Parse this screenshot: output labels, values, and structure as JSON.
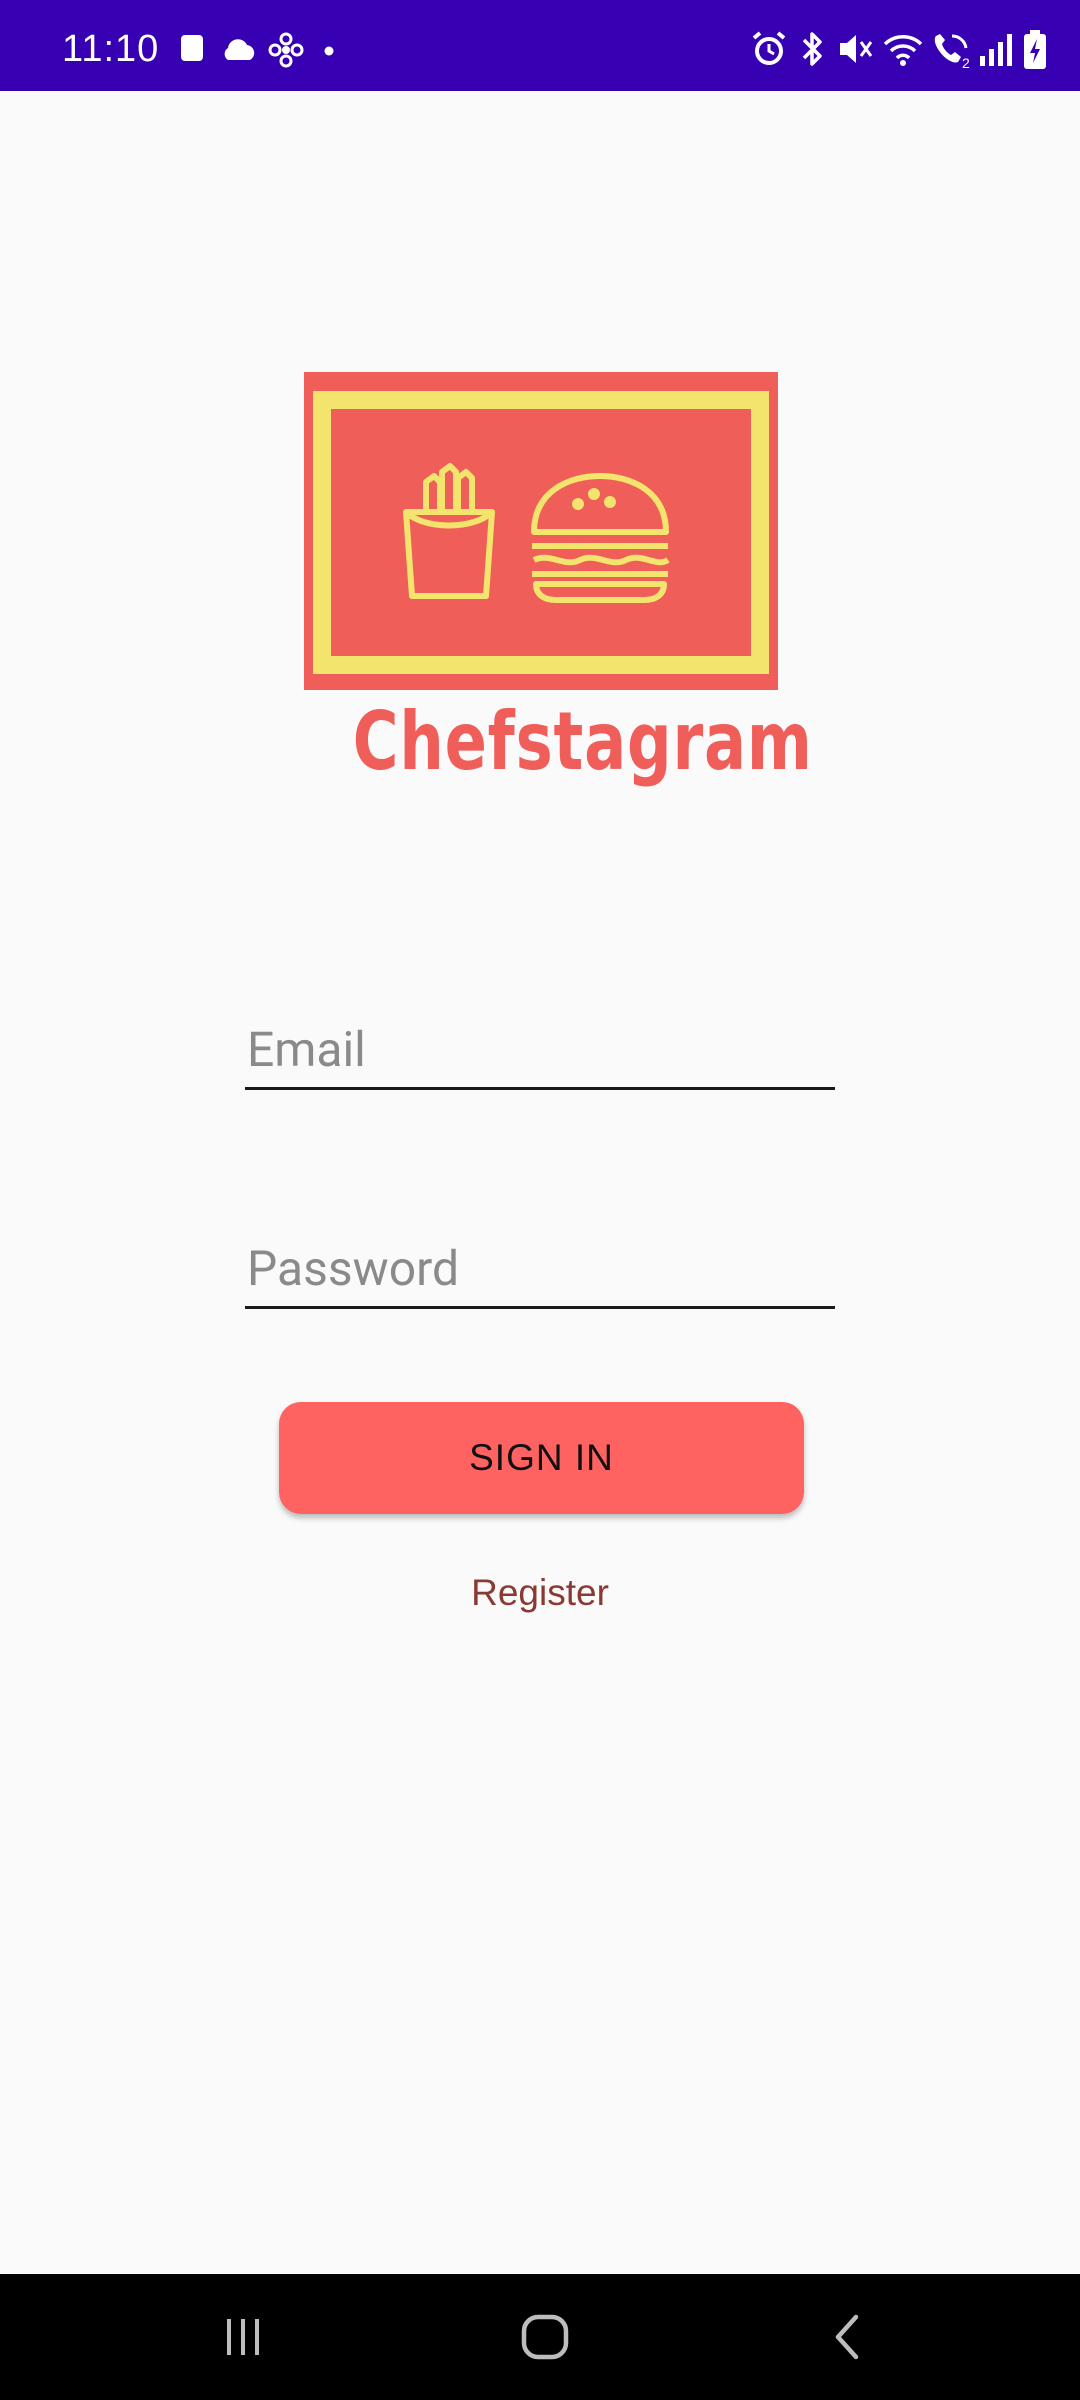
{
  "status_bar": {
    "time": "11:10",
    "left_icons": [
      "notification-square-icon",
      "cloud-icon",
      "fan-icon",
      "dot-icon"
    ],
    "right_icons": [
      "alarm-icon",
      "bluetooth-icon",
      "mute-icon",
      "wifi-icon",
      "wifi-calling-icon",
      "signal-icon",
      "battery-charging-icon"
    ],
    "background": "#3700b3"
  },
  "app": {
    "brand_name": "Chefstagram",
    "brand_color": "#f05e5a",
    "logo_accent": "#f3e46e"
  },
  "form": {
    "email_placeholder": "Email",
    "email_value": "",
    "password_placeholder": "Password",
    "password_value": "",
    "signin_label": "SIGN IN",
    "register_label": "Register"
  },
  "nav_bar": {
    "buttons": [
      "recents-icon",
      "home-icon",
      "back-icon"
    ]
  }
}
